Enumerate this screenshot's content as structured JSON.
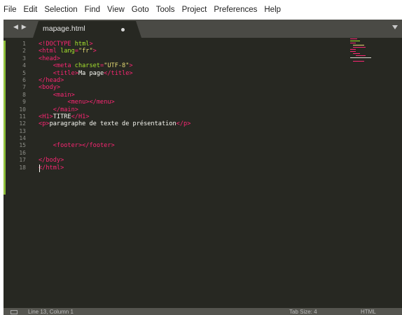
{
  "menu": [
    "File",
    "Edit",
    "Selection",
    "Find",
    "View",
    "Goto",
    "Tools",
    "Project",
    "Preferences",
    "Help"
  ],
  "tab": {
    "title": "mapage.html",
    "modified": true
  },
  "gutter": [
    "1",
    "2",
    "3",
    "4",
    "5",
    "6",
    "7",
    "8",
    "9",
    "10",
    "11",
    "12",
    "13",
    "14",
    "15",
    "16",
    "17",
    "18"
  ],
  "code_lines": [
    [
      {
        "t": "<!",
        "c": "kw"
      },
      {
        "t": "DOCTYPE",
        "c": "kw"
      },
      {
        "t": " html",
        "c": "at"
      },
      {
        "t": ">",
        "c": "kw"
      }
    ],
    [
      {
        "t": "<",
        "c": "kw"
      },
      {
        "t": "html",
        "c": "kw"
      },
      {
        "t": " lang",
        "c": "at"
      },
      {
        "t": "=",
        "c": "kw"
      },
      {
        "t": "\"fr\"",
        "c": "st"
      },
      {
        "t": ">",
        "c": "kw"
      }
    ],
    [
      {
        "t": "<",
        "c": "kw"
      },
      {
        "t": "head",
        "c": "kw"
      },
      {
        "t": ">",
        "c": "kw"
      }
    ],
    [
      {
        "t": "    "
      },
      {
        "t": "<",
        "c": "kw"
      },
      {
        "t": "meta",
        "c": "kw"
      },
      {
        "t": " charset",
        "c": "at"
      },
      {
        "t": "=",
        "c": "kw"
      },
      {
        "t": "\"UTF-8\"",
        "c": "st"
      },
      {
        "t": ">",
        "c": "kw"
      }
    ],
    [
      {
        "t": "    "
      },
      {
        "t": "<",
        "c": "kw"
      },
      {
        "t": "title",
        "c": "kw"
      },
      {
        "t": ">",
        "c": "kw"
      },
      {
        "t": "Ma page"
      },
      {
        "t": "</",
        "c": "kw"
      },
      {
        "t": "title",
        "c": "kw"
      },
      {
        "t": ">",
        "c": "kw"
      }
    ],
    [
      {
        "t": "</",
        "c": "kw"
      },
      {
        "t": "head",
        "c": "kw"
      },
      {
        "t": ">",
        "c": "kw"
      }
    ],
    [
      {
        "t": "<",
        "c": "kw"
      },
      {
        "t": "body",
        "c": "kw"
      },
      {
        "t": ">",
        "c": "kw"
      }
    ],
    [
      {
        "t": "    "
      },
      {
        "t": "<",
        "c": "kw"
      },
      {
        "t": "main",
        "c": "kw"
      },
      {
        "t": ">",
        "c": "kw"
      }
    ],
    [
      {
        "t": "        "
      },
      {
        "t": "<",
        "c": "kw"
      },
      {
        "t": "menu",
        "c": "kw"
      },
      {
        "t": ">",
        "c": "kw"
      },
      {
        "t": "</",
        "c": "kw"
      },
      {
        "t": "menu",
        "c": "kw"
      },
      {
        "t": ">",
        "c": "kw"
      }
    ],
    [
      {
        "t": "    "
      },
      {
        "t": "</",
        "c": "kw"
      },
      {
        "t": "main",
        "c": "kw"
      },
      {
        "t": ">",
        "c": "kw"
      }
    ],
    [
      {
        "t": "<",
        "c": "kw"
      },
      {
        "t": "H1",
        "c": "kw"
      },
      {
        "t": ">",
        "c": "kw"
      },
      {
        "t": "TITRE"
      },
      {
        "t": "</",
        "c": "kw"
      },
      {
        "t": "H1",
        "c": "kw"
      },
      {
        "t": ">",
        "c": "kw"
      }
    ],
    [
      {
        "t": "<",
        "c": "kw"
      },
      {
        "t": "p",
        "c": "kw"
      },
      {
        "t": ">",
        "c": "kw"
      },
      {
        "t": "paragraphe de texte de présentation"
      },
      {
        "t": "</",
        "c": "kw"
      },
      {
        "t": "p",
        "c": "kw"
      },
      {
        "t": ">",
        "c": "kw"
      }
    ],
    [],
    [],
    [
      {
        "t": "    "
      },
      {
        "t": "<",
        "c": "kw"
      },
      {
        "t": "footer",
        "c": "kw"
      },
      {
        "t": ">",
        "c": "kw"
      },
      {
        "t": "</",
        "c": "kw"
      },
      {
        "t": "footer",
        "c": "kw"
      },
      {
        "t": ">",
        "c": "kw"
      }
    ],
    [],
    [
      {
        "t": "</",
        "c": "kw"
      },
      {
        "t": "body",
        "c": "kw"
      },
      {
        "t": ">",
        "c": "kw"
      }
    ],
    [
      {
        "t": "</",
        "c": "kw"
      },
      {
        "t": "html",
        "c": "kw"
      },
      {
        "t": ">",
        "c": "kw"
      }
    ]
  ],
  "status": {
    "position": "Line 13, Column 1",
    "tab_size": "Tab Size: 4",
    "syntax": "HTML"
  },
  "colors": {
    "background": "#272822",
    "tag": "#f92672",
    "attribute": "#a6e22e",
    "string": "#e6db74",
    "text": "#f8f8f2"
  }
}
